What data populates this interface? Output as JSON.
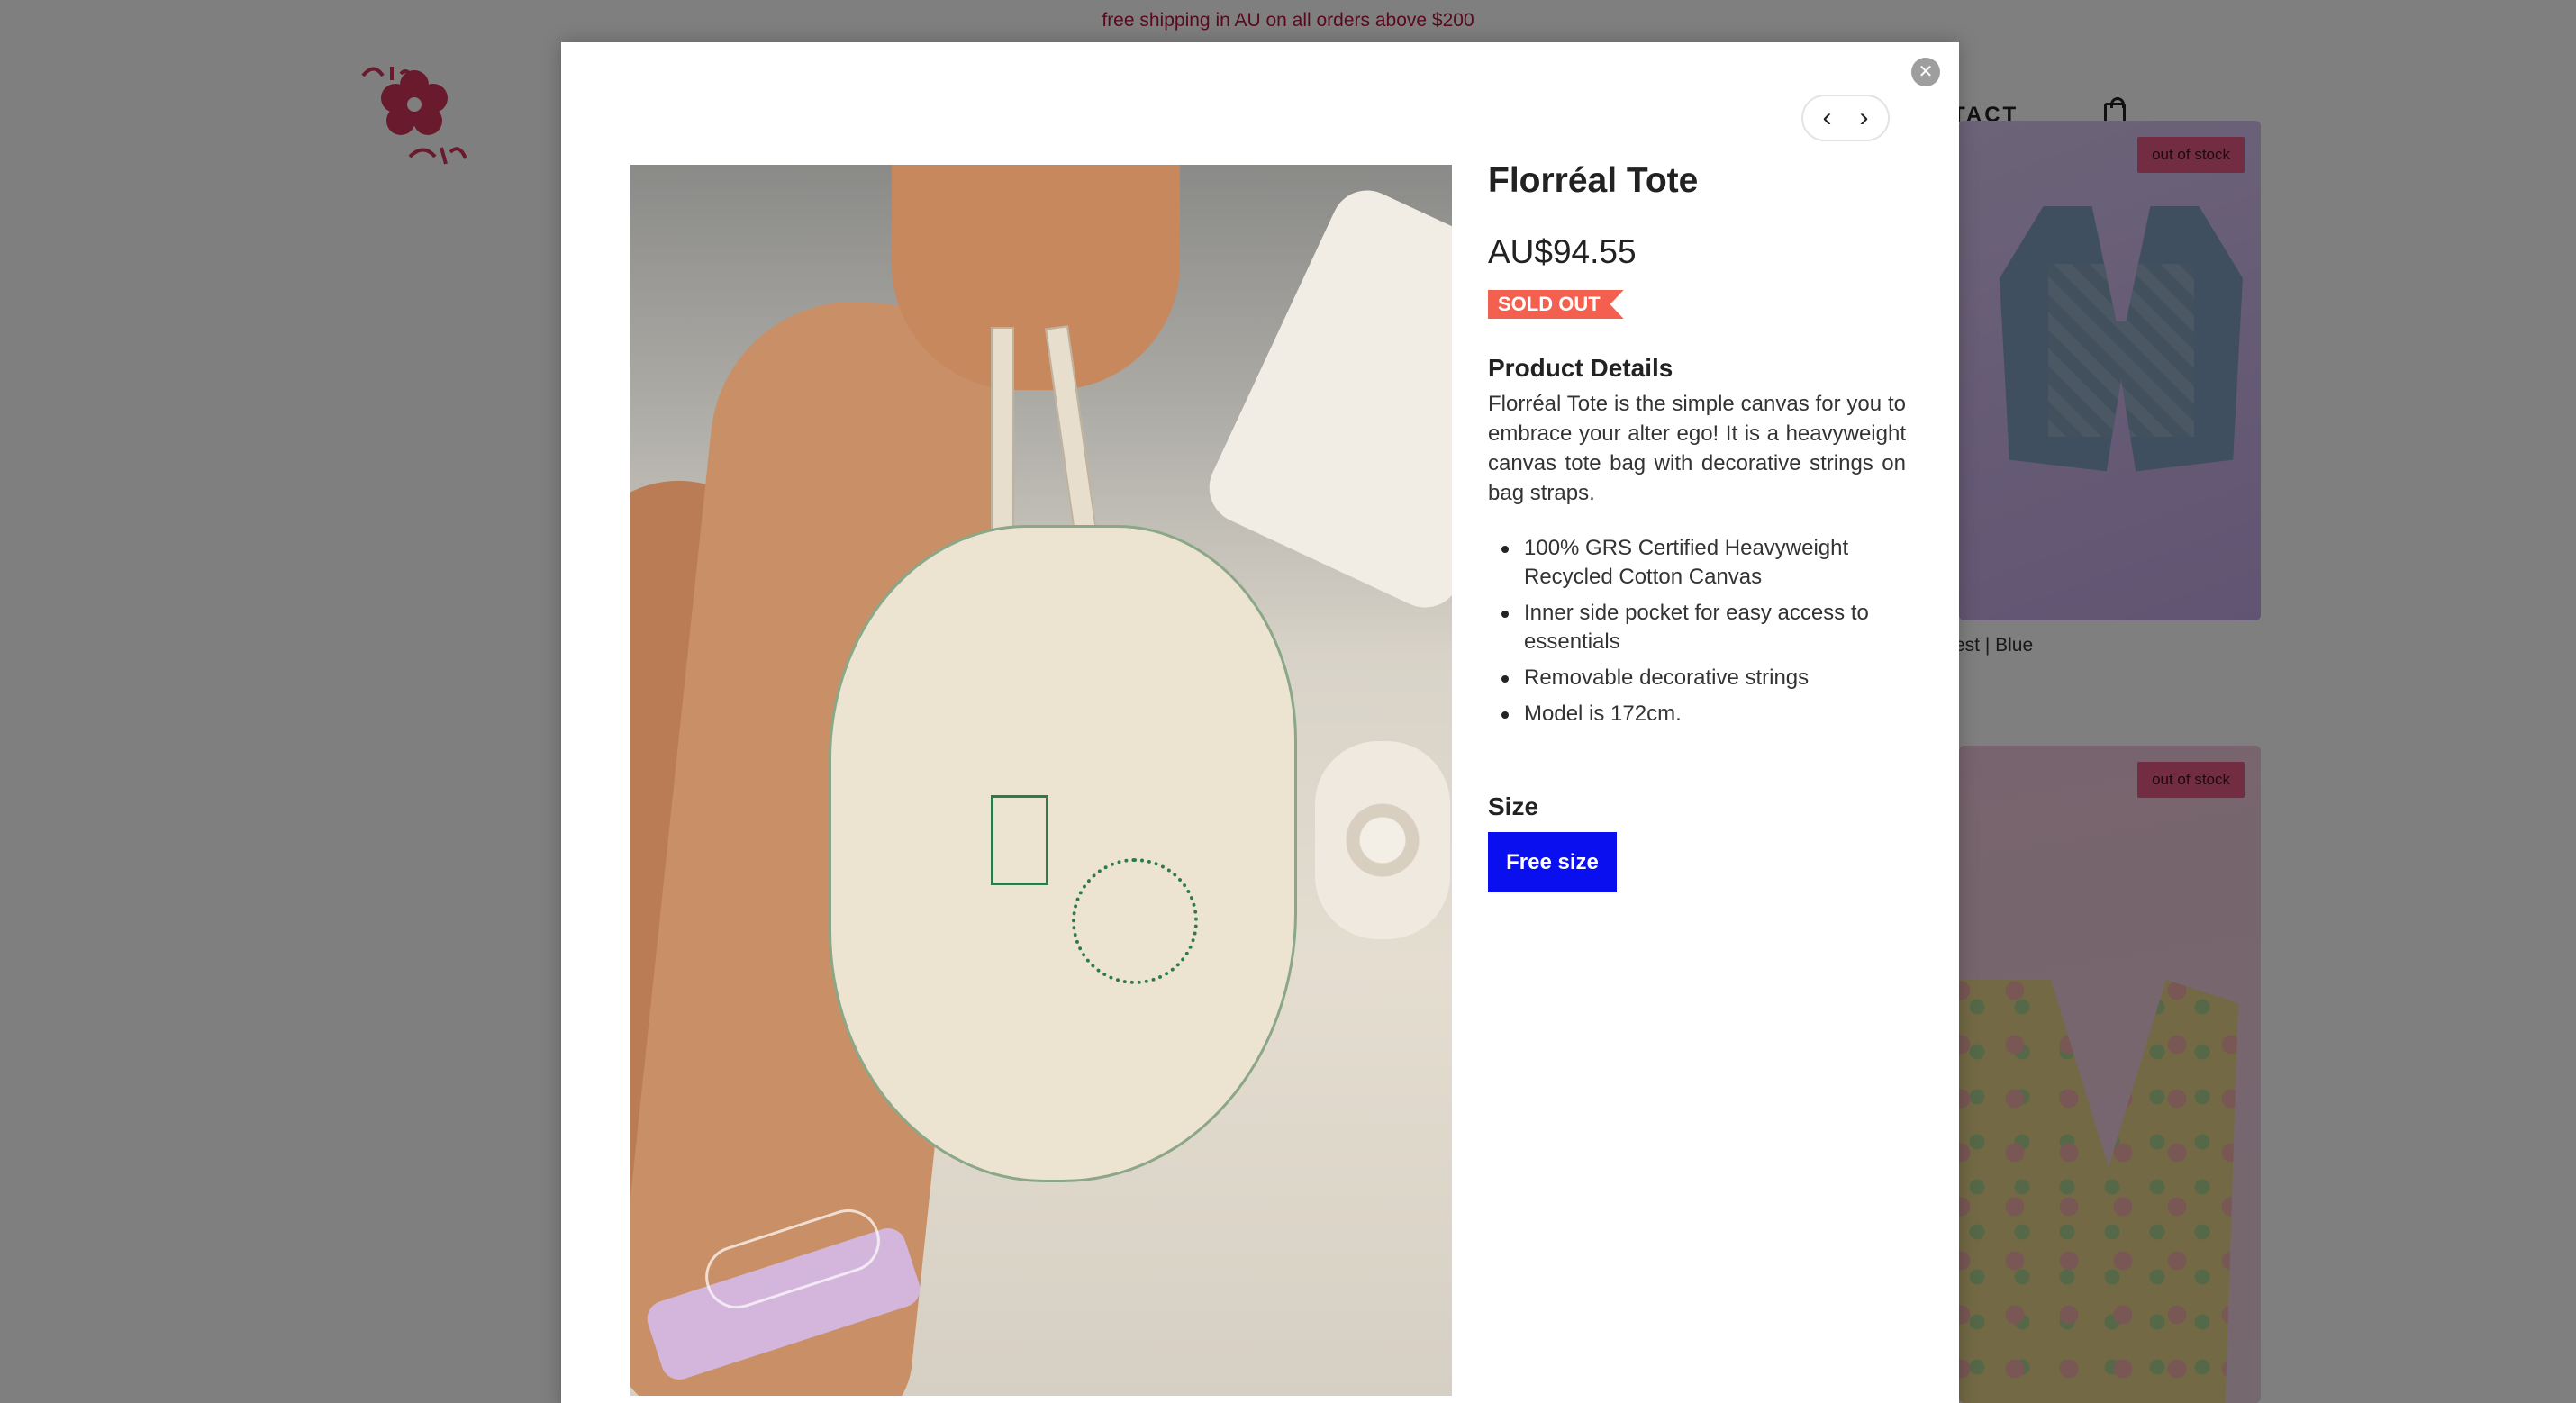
{
  "announcement": "free shipping in AU on all orders above $200",
  "brand": {
    "logo_alt": "Alter Real",
    "logo_icon": "flower-logo-icon",
    "color": "#d3355a"
  },
  "nav": {
    "contact": "ONTACT",
    "cart_icon": "shopping-bag-icon"
  },
  "background_products": [
    {
      "badge": "out of stock",
      "caption": "est | Blue"
    },
    {
      "badge": "out of stock"
    }
  ],
  "modal": {
    "close_icon": "close-icon",
    "pager": {
      "prev_icon": "chevron-left-icon",
      "next_icon": "chevron-right-icon"
    },
    "product": {
      "title": "Florréal Tote",
      "price": "AU$94.55",
      "status": "SOLD OUT",
      "details_heading": "Product Details",
      "description": "Florréal Tote is the simple canvas for you to embrace your alter ego! It is a heavyweight canvas tote bag with decorative strings on bag straps.",
      "features": [
        "100% GRS Certified Heavyweight Recycled Cotton Canvas",
        "Inner side pocket for easy access to essentials",
        "Removable decorative strings",
        "Model is 172cm."
      ],
      "size_heading": "Size",
      "size_option": "Free size"
    }
  },
  "colors": {
    "accent": "#0a0ff0",
    "sold_out": "#f4604f",
    "announcement_text": "#b0173f"
  }
}
